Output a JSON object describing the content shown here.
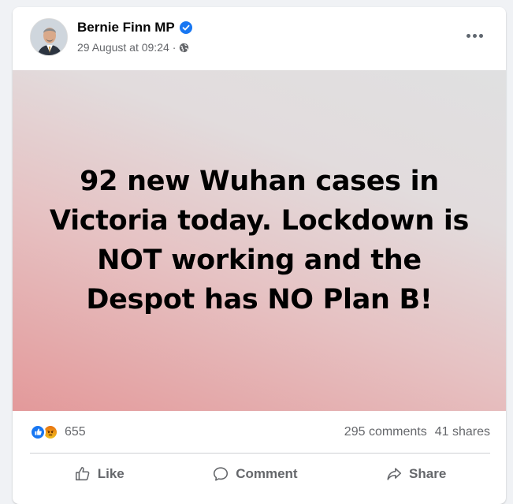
{
  "post": {
    "author": "Bernie Finn MP",
    "timestamp": "29 August at 09:24",
    "separator": "·",
    "privacy_icon": "globe-icon",
    "verified_icon": "verified-badge-icon",
    "image_text": "92 new Wuhan cases in Victoria today. Lockdown is NOT working and the Despot has NO Plan B!"
  },
  "stats": {
    "reaction_icons": [
      "like-reaction-icon",
      "angry-reaction-icon"
    ],
    "reaction_count": "655",
    "comments": "295 comments",
    "shares": "41 shares"
  },
  "actions": {
    "like": "Like",
    "comment": "Comment",
    "share": "Share"
  },
  "colors": {
    "accent": "#1877f2",
    "muted_text": "#65676b",
    "card_bg": "#ffffff",
    "page_bg": "#f0f2f5"
  }
}
